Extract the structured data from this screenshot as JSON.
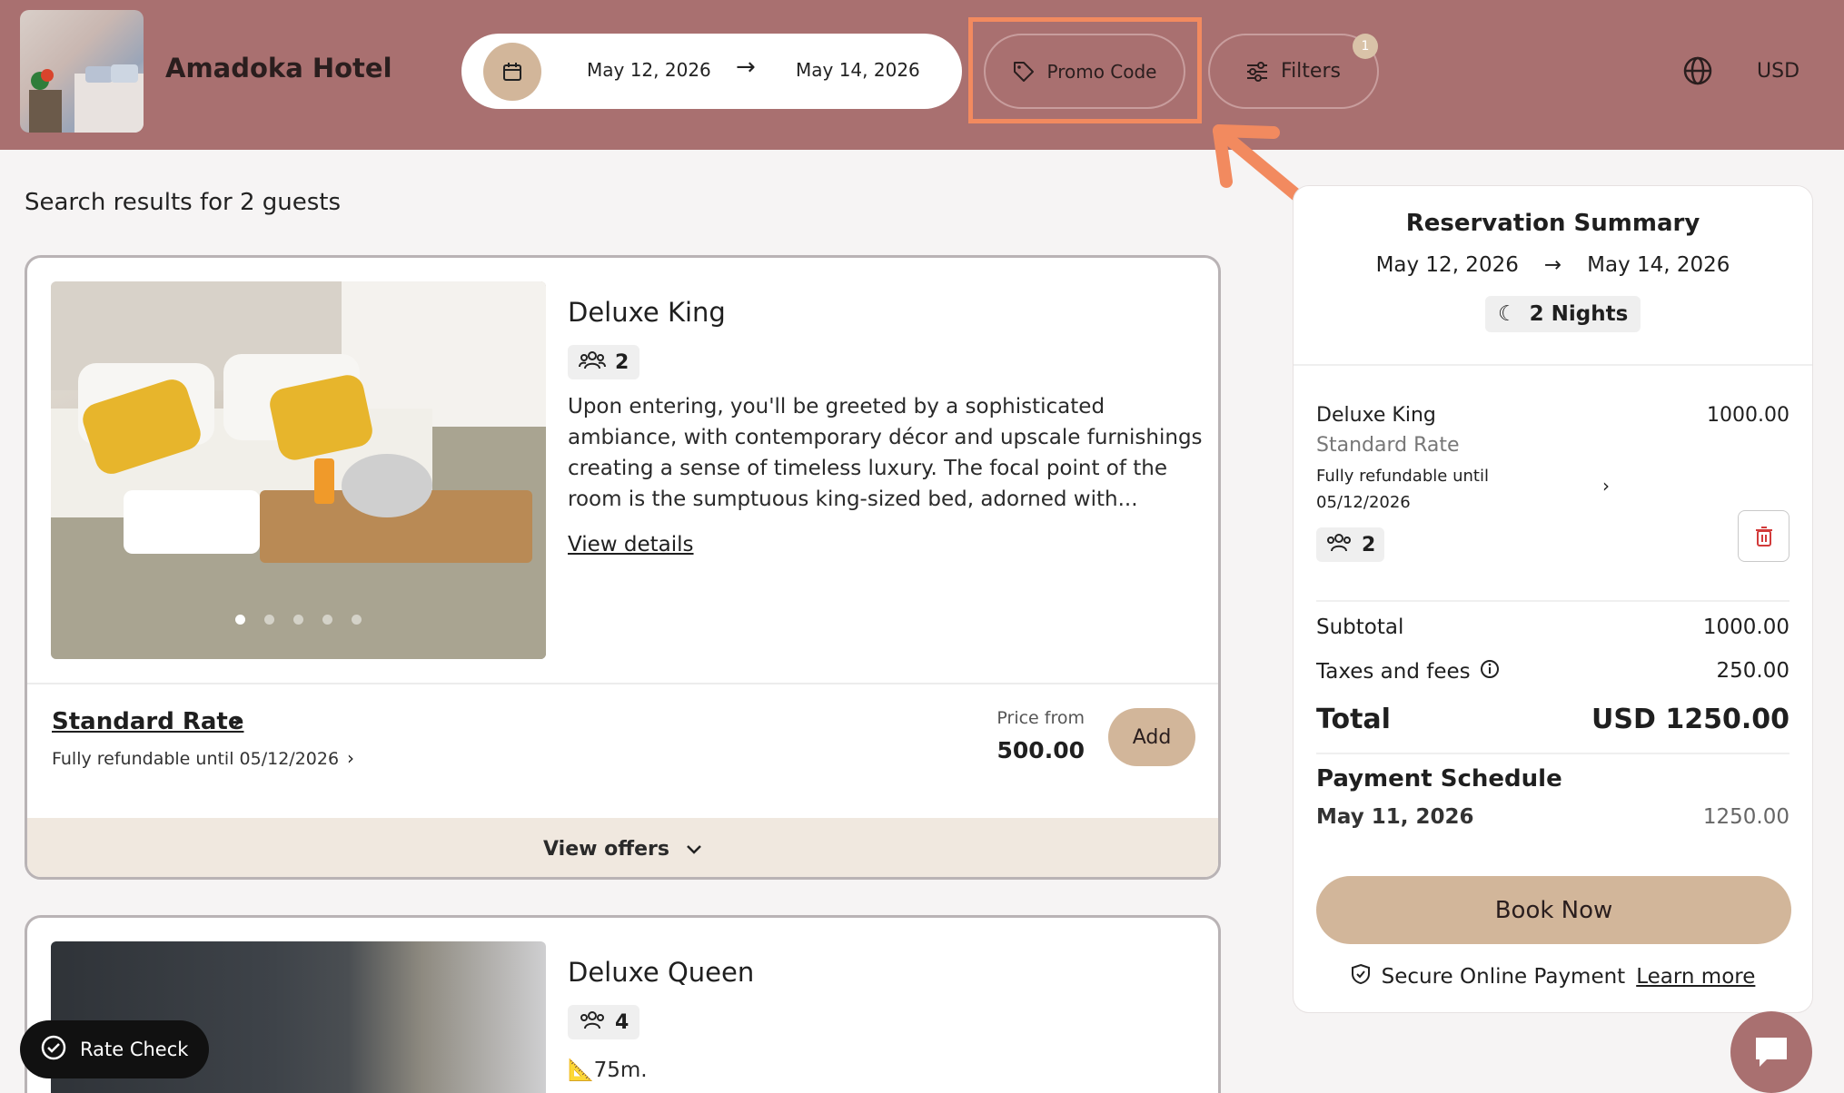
{
  "header": {
    "hotel_name": "Amadoka Hotel",
    "check_in": "May 12, 2026",
    "check_out": "May 14, 2026",
    "promo_label": "Promo Code",
    "filters_label": "Filters",
    "filters_count": "1",
    "currency": "USD"
  },
  "results": {
    "title": "Search results for 2 guests"
  },
  "rooms": [
    {
      "name": "Deluxe King",
      "guests": "2",
      "description": "Upon entering, you'll be greeted by a sophisticated ambiance, with contemporary décor and upscale furnishings creating a sense of timeless luxury. The focal point of the room is the sumptuous king-sized bed, adorned with...",
      "view_details": "View details",
      "rate_name": "Standard Rate",
      "rate_refund": "Fully refundable until 05/12/2026",
      "price_from_label": "Price from",
      "price": "500.00",
      "add_label": "Add",
      "view_offers": "View offers"
    },
    {
      "name": "Deluxe Queen",
      "guests": "4",
      "area": "📐75m."
    }
  ],
  "summary": {
    "title": "Reservation Summary",
    "check_in": "May 12, 2026",
    "check_out": "May 14, 2026",
    "nights": "2 Nights",
    "item_name": "Deluxe King",
    "item_price": "1000.00",
    "item_rate": "Standard Rate",
    "item_refund": "Fully refundable until 05/12/2026",
    "item_guests": "2",
    "subtotal_label": "Subtotal",
    "subtotal": "1000.00",
    "taxes_label": "Taxes and fees",
    "taxes": "250.00",
    "total_label": "Total",
    "total": "USD 1250.00",
    "schedule_title": "Payment Schedule",
    "schedule_date": "May 11, 2026",
    "schedule_amount": "1250.00",
    "book_label": "Book Now",
    "secure_text": "Secure Online Payment",
    "learn_more": "Learn more"
  },
  "floating": {
    "rate_check": "Rate Check"
  },
  "colors": {
    "header_bg": "#a97070",
    "accent": "#d2b69a",
    "highlight": "#f28a5f"
  }
}
